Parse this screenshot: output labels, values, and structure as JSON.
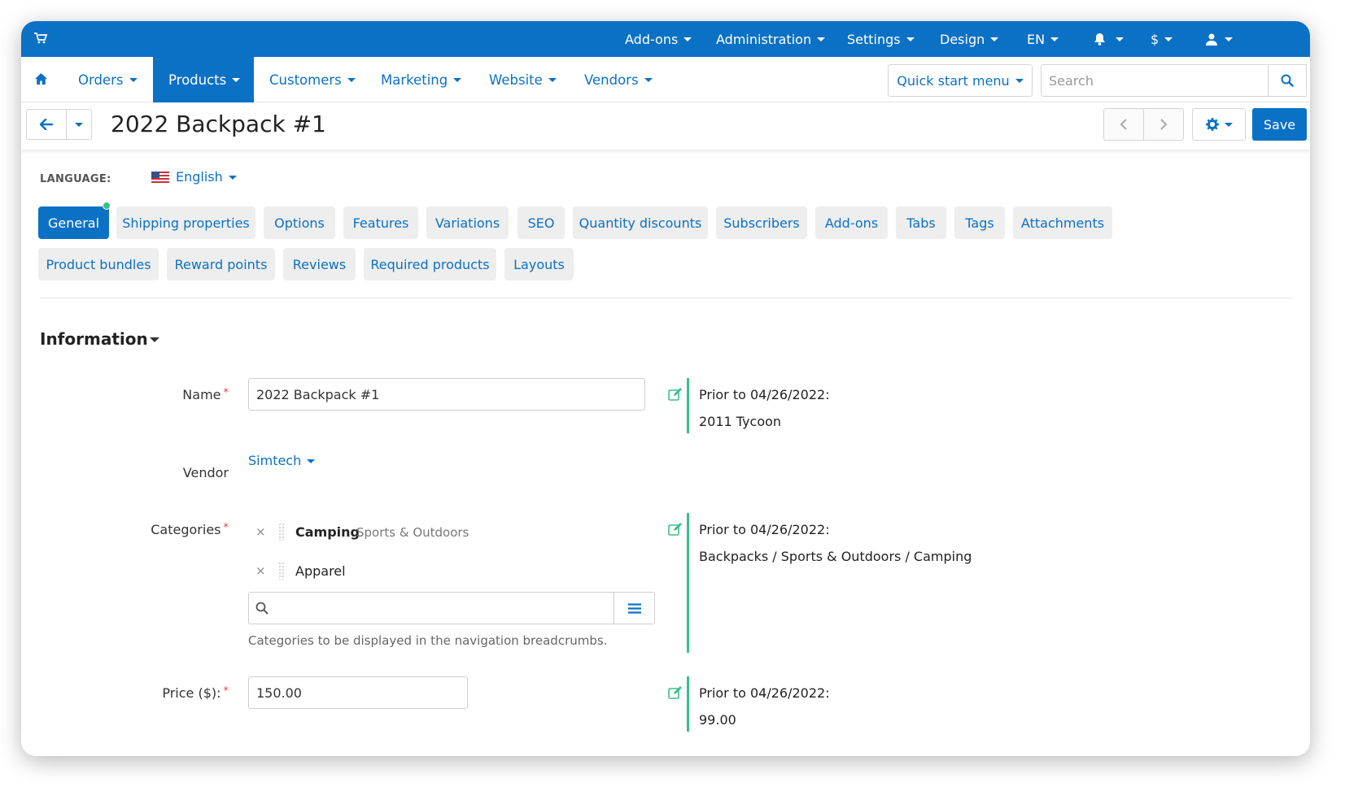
{
  "topbar": {
    "menus": [
      "Add-ons",
      "Administration",
      "Settings",
      "Design",
      "EN"
    ],
    "currency": "$"
  },
  "nav": {
    "items": [
      "Orders",
      "Products",
      "Customers",
      "Marketing",
      "Website",
      "Vendors"
    ],
    "active": "Products",
    "quick_start": "Quick start menu",
    "search_placeholder": "Search"
  },
  "title": "2022 Backpack #1",
  "toolbar": {
    "save_label": "Save"
  },
  "language": {
    "label": "LANGUAGE:",
    "value": "English"
  },
  "tabs": {
    "row1": [
      "General",
      "Shipping properties",
      "Options",
      "Features",
      "Variations",
      "SEO",
      "Quantity discounts",
      "Subscribers",
      "Add-ons",
      "Tabs",
      "Tags",
      "Attachments"
    ],
    "row2": [
      "Product bundles",
      "Reward points",
      "Reviews",
      "Required products",
      "Layouts"
    ],
    "active": "General"
  },
  "section": {
    "title": "Information"
  },
  "form": {
    "name": {
      "label": "Name",
      "value": "2022 Backpack #1",
      "prior_label": "Prior to 04/26/2022:",
      "prior_value": "2011 Tycoon"
    },
    "vendor": {
      "label": "Vendor",
      "value": "Simtech"
    },
    "categories": {
      "label": "Categories",
      "items": [
        {
          "name": "Camping",
          "path": "Sports & Outdoors"
        },
        {
          "name": "Apparel",
          "path": ""
        }
      ],
      "help": "Categories to be displayed in the navigation breadcrumbs.",
      "prior_label": "Prior to 04/26/2022:",
      "prior_value": "Backpacks / Sports & Outdoors / Camping"
    },
    "price": {
      "label": "Price ($):",
      "value": "150.00",
      "prior_label": "Prior to 04/26/2022:",
      "prior_value": "99.00"
    }
  },
  "colors": {
    "primary": "#0b71c5",
    "accent": "#39c08a",
    "required": "#e63c3c"
  }
}
